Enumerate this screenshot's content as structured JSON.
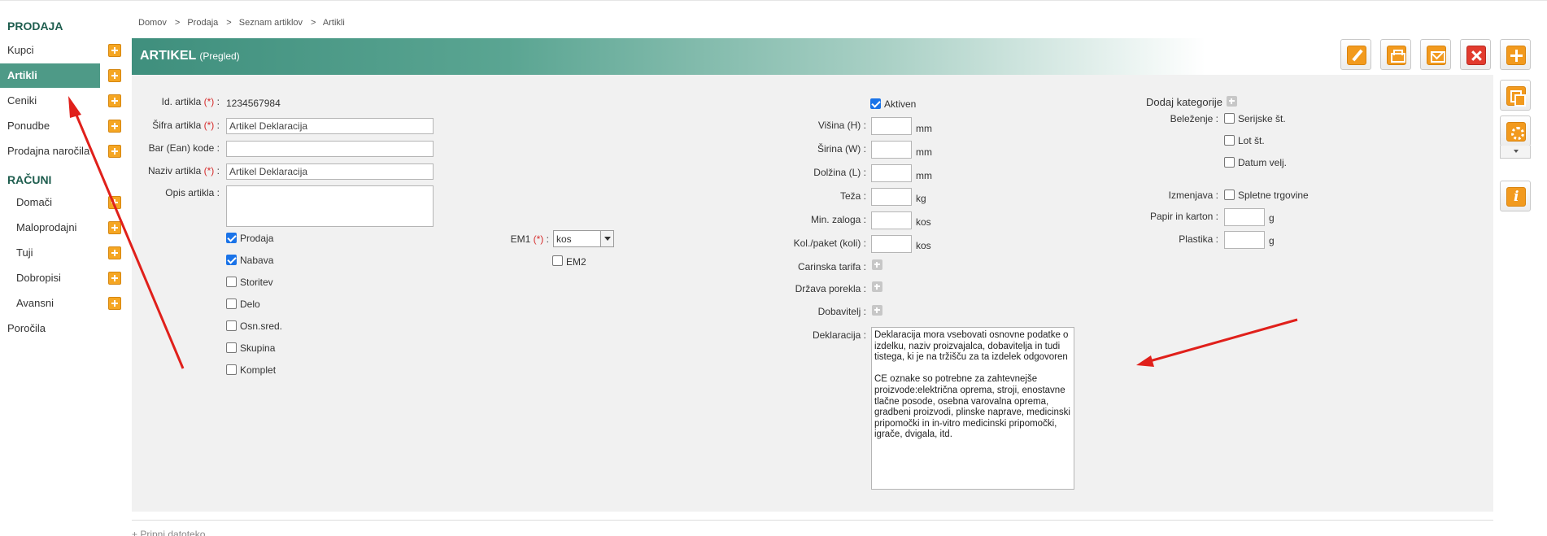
{
  "sidebar": {
    "section1": "PRODAJA",
    "items1": [
      {
        "label": "Kupci"
      },
      {
        "label": "Artikli"
      },
      {
        "label": "Ceniki"
      },
      {
        "label": "Ponudbe"
      },
      {
        "label": "Prodajna naročila"
      }
    ],
    "section2": "RAČUNI",
    "items2": [
      {
        "label": "Domači"
      },
      {
        "label": "Maloprodajni"
      },
      {
        "label": "Tuji"
      },
      {
        "label": "Dobropisi"
      },
      {
        "label": "Avansni"
      }
    ],
    "reports": "Poročila"
  },
  "breadcrumb": [
    "Domov",
    "Prodaja",
    "Seznam artiklov",
    "Artikli"
  ],
  "breadcrumb_sep": ">",
  "header": {
    "title": "ARTIKEL",
    "subtitle": "(Pregled)"
  },
  "toolbar": [
    "pencil-icon",
    "printer-icon",
    "mail-icon",
    "close-icon",
    "plus-icon",
    "copy-icon",
    "gear-icon",
    "info-icon"
  ],
  "form": {
    "id_label": "Id. artikla",
    "id_value": "1234567984",
    "sifra_label": "Šifra artikla",
    "sifra_value": "Artikel Deklaracija",
    "ean_label": "Bar (Ean) kode",
    "ean_value": "",
    "naziv_label": "Naziv artikla",
    "naziv_value": "Artikel Deklaracija",
    "opis_label": "Opis artikla",
    "opis_value": "",
    "required_mark": "(*)",
    "colon": ":",
    "types": [
      {
        "label": "Prodaja",
        "checked": true
      },
      {
        "label": "Nabava",
        "checked": true
      },
      {
        "label": "Storitev",
        "checked": false
      },
      {
        "label": "Delo",
        "checked": false
      },
      {
        "label": "Osn.sred.",
        "checked": false
      },
      {
        "label": "Skupina",
        "checked": false
      },
      {
        "label": "Komplet",
        "checked": false
      }
    ],
    "em1_label": "EM1",
    "em1_value": "kos",
    "em2_label": "EM2",
    "aktiven_label": "Aktiven",
    "dims": [
      {
        "label": "Višina (H)",
        "unit": "mm"
      },
      {
        "label": "Širina (W)",
        "unit": "mm"
      },
      {
        "label": "Dolžina (L)",
        "unit": "mm"
      },
      {
        "label": "Teža",
        "unit": "kg"
      },
      {
        "label": "Min. zaloga",
        "unit": "kos"
      },
      {
        "label": "Kol./paket (koli)",
        "unit": "kos"
      }
    ],
    "carinska_label": "Carinska tarifa",
    "drzava_label": "Država porekla",
    "dobavitelj_label": "Dobavitelj",
    "deklaracija_label": "Deklaracija",
    "deklaracija_value": "Deklaracija mora vsebovati osnovne podatke o izdelku, naziv proizvajalca, dobavitelja in tudi tistega, ki je na tržišču za ta izdelek odgovoren\n\nCE oznake so potrebne za zahtevnejše proizvode:električna oprema, stroji, enostavne tlačne posode, osebna varovalna oprema, gradbeni proizvodi, plinske naprave, medicinski pripomočki in in-vitro medicinski pripomočki, igrače, dvigala, itd.",
    "kategorije_label": "Dodaj kategorije",
    "belezenje_label": "Beleženje",
    "belezenje_opts": [
      {
        "label": "Serijske št.",
        "checked": false
      },
      {
        "label": "Lot št.",
        "checked": false
      },
      {
        "label": "Datum velj.",
        "checked": false
      }
    ],
    "izmenjava_label": "Izmenjava",
    "izmenjava_opt": "Spletne trgovine",
    "papir_label": "Papir in karton",
    "papir_unit": "g",
    "plastika_label": "Plastika",
    "plastika_unit": "g"
  },
  "footer": {
    "attach": "+ Pripni datoteko"
  },
  "colors": {
    "accent": "#4e9a87",
    "arrow": "#e0201b",
    "toolbar_orange": "#f29a1e"
  }
}
